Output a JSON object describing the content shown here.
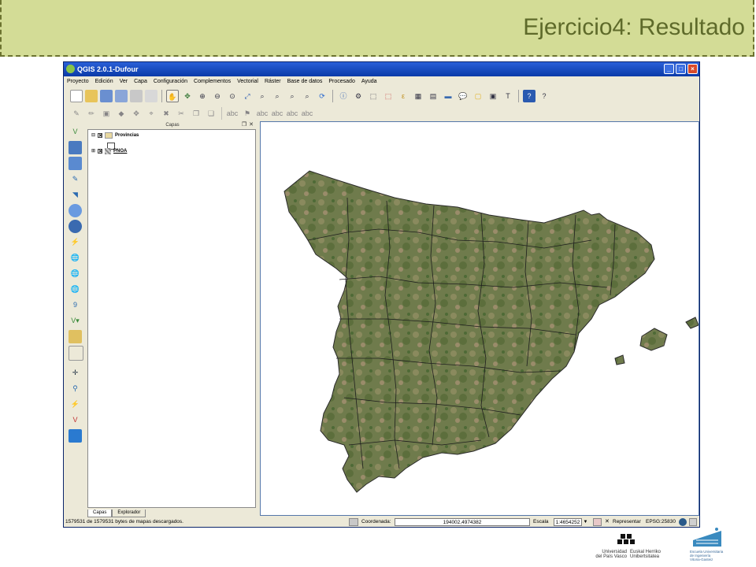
{
  "slide": {
    "title": "Ejercicio4: Resultado"
  },
  "window": {
    "title": "QGIS 2.0.1-Dufour"
  },
  "menu": [
    "Proyecto",
    "Edición",
    "Ver",
    "Capa",
    "Configuración",
    "Complementos",
    "Vectorial",
    "Ráster",
    "Base de datos",
    "Procesado",
    "Ayuda"
  ],
  "panel": {
    "title": "Capas",
    "layers": [
      {
        "name": "Provincias",
        "checked": true,
        "expanded": true
      },
      {
        "name": "PNOA",
        "checked": true,
        "expanded": false
      }
    ],
    "tabs": [
      {
        "label": "Capas",
        "active": true
      },
      {
        "label": "Explorador",
        "active": false
      }
    ]
  },
  "status": {
    "message": "1579531 de 1579531 bytes de mapas descargados.",
    "coord_label": "Coordenada:",
    "coord_value": "194002,4974382",
    "scale_label": "Escala",
    "scale_value": "1:4654252",
    "render_label": "Representar",
    "render_checked": true,
    "crs": "EPSG:25830"
  },
  "footer": {
    "left_logo": [
      "Universidad",
      "del País Vasco",
      "Euskal Herriko",
      "Unibertsitatea"
    ],
    "right_logo": [
      "Escuela Universitaria",
      "de Ingeniería",
      "Vitoria-Gasteiz"
    ]
  },
  "colors": {
    "header_bg": "#d3dc96",
    "title_text": "#5e6a2a",
    "titlebar": "#0a3aa8"
  }
}
